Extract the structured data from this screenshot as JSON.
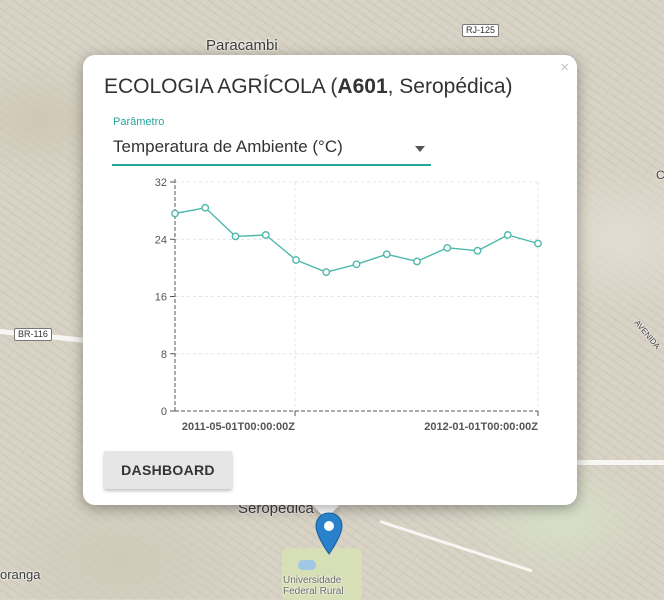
{
  "map": {
    "labels": {
      "town_north": "Paracambi",
      "town_south": "Seropédica",
      "town_left": "oranga",
      "campus_line1": "Universidade",
      "campus_line2": "Federal Rural",
      "avenue": "AVENIDA",
      "edge_c": "C"
    },
    "shields": {
      "rj125": "RJ-125",
      "br116": "BR-116"
    }
  },
  "popup": {
    "close_symbol": "×",
    "title_prefix": "ECOLOGIA AGRÍCOLA (",
    "title_code": "A601",
    "title_suffix": ", Seropédica)",
    "parameter_label": "Parâmetro",
    "parameter_value": "Temperatura de Ambiente (°C)",
    "dashboard_label": "DASHBOARD"
  },
  "colors": {
    "accent": "#26a69a",
    "line": "#4fb8ac",
    "marker": "#2a81cb"
  },
  "chart_data": {
    "type": "line",
    "title": "",
    "xlabel": "",
    "ylabel": "",
    "ylim": [
      0,
      32
    ],
    "yticks": [
      0,
      8,
      16,
      24,
      32
    ],
    "xticks": [
      "2011-05-01T00:00:00Z",
      "2012-01-01T00:00:00Z"
    ],
    "grid": true,
    "series": [
      {
        "values": [
          27.6,
          28.4,
          24.4,
          24.6,
          21.1,
          19.4,
          20.5,
          21.9,
          20.9,
          22.8,
          22.4,
          24.6,
          23.4
        ]
      }
    ]
  }
}
